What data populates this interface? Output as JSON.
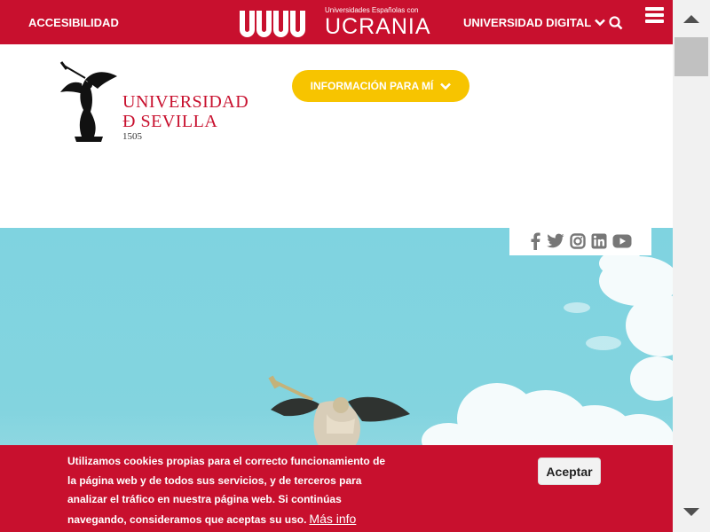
{
  "topbar": {
    "accessibility_label": "ACCESIBILIDAD",
    "ucrania_small": "Universidades Españolas con",
    "ucrania_big": "UCRANIA",
    "universidad_digital_label": "UNIVERSIDAD DIGITAL",
    "bg_color": "#c8102e"
  },
  "header": {
    "logo_line1": "UNIVERSIDAD",
    "logo_line2": "Ð SEVILLA",
    "logo_year": "1505",
    "info_button_label": "INFORMACIÓN PARA MÍ",
    "info_button_color": "#f7c400"
  },
  "social": {
    "icons": [
      "facebook-icon",
      "twitter-icon",
      "instagram-icon",
      "linkedin-icon",
      "youtube-icon"
    ]
  },
  "cookie": {
    "text": "Utilizamos cookies propias para el correcto funcionamiento de la página web y de todos sus servicios, y de terceros para analizar el tráfico en nuestra página web. Si continúas navegando, consideramos que aceptas su uso.",
    "link_label": "Más info",
    "accept_label": "Aceptar"
  }
}
